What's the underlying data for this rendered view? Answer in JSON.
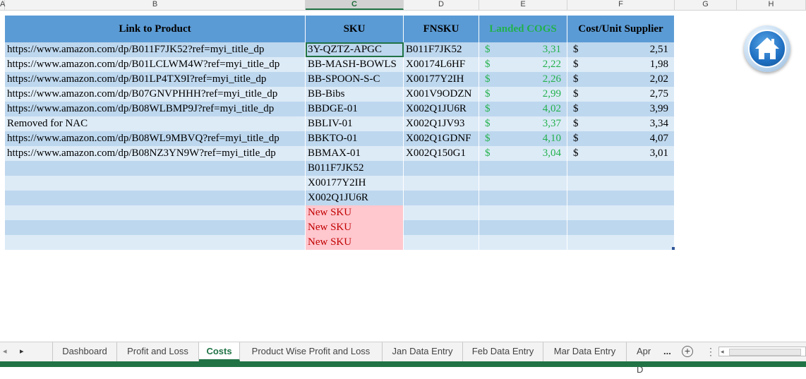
{
  "column_headers": [
    "A",
    "B",
    "C",
    "D",
    "E",
    "F",
    "G",
    "H"
  ],
  "selected_column": "C",
  "table": {
    "headers": {
      "link": "Link to Product",
      "sku": "SKU",
      "fnsku": "FNSKU",
      "landed": "Landed COGS",
      "supplier": "Cost/Unit Supplier"
    },
    "rows": [
      {
        "link": "https://www.amazon.com/dp/B011F7JK52?ref=myi_title_dp",
        "sku": "3Y-QZTZ-APGC",
        "fnsku": "B011F7JK52",
        "landed_symbol": "$",
        "landed": "3,31",
        "supplier_symbol": "$",
        "supplier": "2,51"
      },
      {
        "link": "https://www.amazon.com/dp/B01LCLWM4W?ref=myi_title_dp",
        "sku": "BB-MASH-BOWLS",
        "fnsku": "X00174L6HF",
        "landed_symbol": "$",
        "landed": "2,22",
        "supplier_symbol": "$",
        "supplier": "1,98"
      },
      {
        "link": "https://www.amazon.com/dp/B01LP4TX9I?ref=myi_title_dp",
        "sku": "BB-SPOON-S-C",
        "fnsku": "X00177Y2IH",
        "landed_symbol": "$",
        "landed": "2,26",
        "supplier_symbol": "$",
        "supplier": "2,02"
      },
      {
        "link": "https://www.amazon.com/dp/B07GNVPHHH?ref=myi_title_dp",
        "sku": "BB-Bibs",
        "fnsku": "X001V9ODZN",
        "landed_symbol": "$",
        "landed": "2,99",
        "supplier_symbol": "$",
        "supplier": "2,75"
      },
      {
        "link": "https://www.amazon.com/dp/B08WLBMP9J?ref=myi_title_dp",
        "sku": "BBDGE-01",
        "fnsku": "X002Q1JU6R",
        "landed_symbol": "$",
        "landed": "4,02",
        "supplier_symbol": "$",
        "supplier": "3,99"
      },
      {
        "link": "Removed for NAC",
        "sku": "BBLIV-01",
        "fnsku": "X002Q1JV93",
        "landed_symbol": "$",
        "landed": "3,37",
        "supplier_symbol": "$",
        "supplier": "3,34"
      },
      {
        "link": "https://www.amazon.com/dp/B08WL9MBVQ?ref=myi_title_dp",
        "sku": "BBKTO-01",
        "fnsku": "X002Q1GDNF",
        "landed_symbol": "$",
        "landed": "4,10",
        "supplier_symbol": "$",
        "supplier": "4,07"
      },
      {
        "link": "https://www.amazon.com/dp/B08NZ3YN9W?ref=myi_title_dp",
        "sku": "BBMAX-01",
        "fnsku": "X002Q150G1",
        "landed_symbol": "$",
        "landed": "3,04",
        "supplier_symbol": "$",
        "supplier": "3,01"
      },
      {
        "link": "",
        "sku": "B011F7JK52",
        "fnsku": "",
        "landed_symbol": "",
        "landed": "",
        "supplier_symbol": "",
        "supplier": ""
      },
      {
        "link": "",
        "sku": "X00177Y2IH",
        "fnsku": "",
        "landed_symbol": "",
        "landed": "",
        "supplier_symbol": "",
        "supplier": ""
      },
      {
        "link": "",
        "sku": "X002Q1JU6R",
        "fnsku": "",
        "landed_symbol": "",
        "landed": "",
        "supplier_symbol": "",
        "supplier": ""
      },
      {
        "link": "",
        "sku": "New SKU",
        "fnsku": "",
        "landed_symbol": "",
        "landed": "",
        "supplier_symbol": "",
        "supplier": ""
      },
      {
        "link": "",
        "sku": "New SKU",
        "fnsku": "",
        "landed_symbol": "",
        "landed": "",
        "supplier_symbol": "",
        "supplier": ""
      },
      {
        "link": "",
        "sku": "New SKU",
        "fnsku": "",
        "landed_symbol": "",
        "landed": "",
        "supplier_symbol": "",
        "supplier": ""
      }
    ]
  },
  "sheet_tabs": [
    "Dashboard",
    "Profit and Loss",
    "Costs",
    "Product Wise Profit and Loss",
    "Jan Data Entry",
    "Feb Data Entry",
    "Mar Data Entry",
    "Apr D"
  ],
  "active_tab": "Costs",
  "tab_overflow": "...",
  "icons": {
    "home": "home-icon",
    "add_sheet": "plus-circle-icon",
    "nav_prev": "triangle-left-icon",
    "nav_next": "triangle-right-icon"
  },
  "colors": {
    "header_blue": "#5b9bd5",
    "band_dark": "#bdd7ee",
    "band_light": "#ddebf7",
    "green_text": "#22b14c",
    "new_sku_fill": "#ffc7ce",
    "new_sku_text": "#c00000",
    "excel_green": "#217346"
  }
}
